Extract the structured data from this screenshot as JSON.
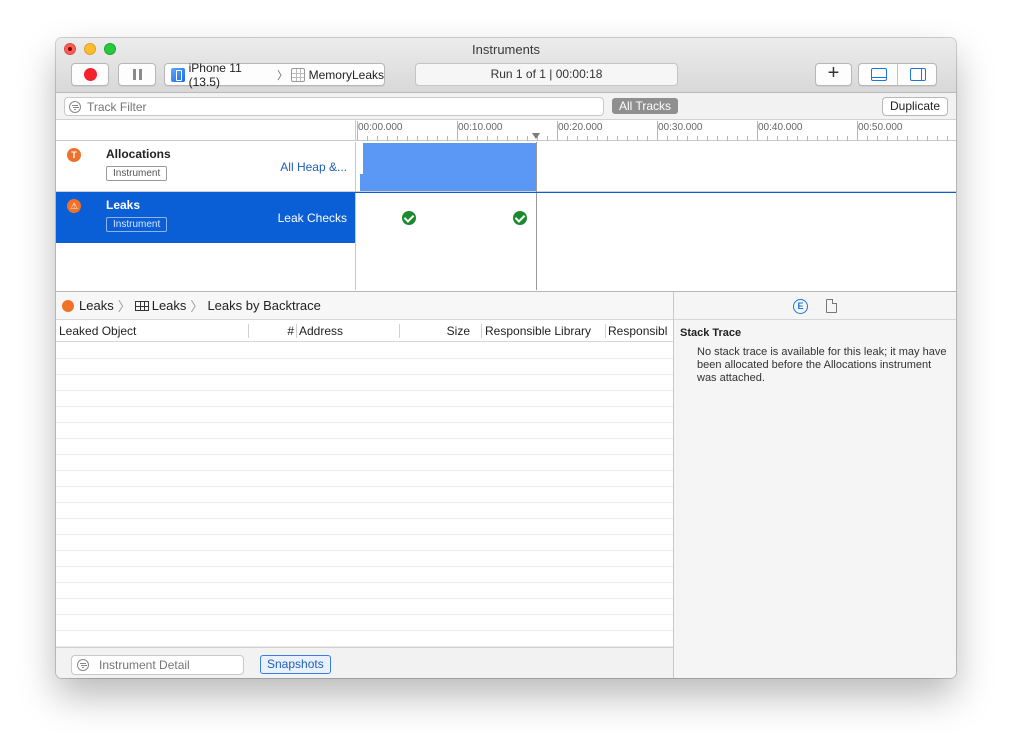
{
  "window": {
    "title": "Instruments"
  },
  "toolbar": {
    "device": "iPhone 11 (13.5)",
    "process": "MemoryLeaks",
    "status": "Run 1 of 1  |  00:00:18",
    "add_label": "+"
  },
  "filter_bar": {
    "track_filter_placeholder": "Track Filter",
    "all_tracks_label": "All Tracks",
    "duplicate_label": "Duplicate"
  },
  "ruler": {
    "labels": [
      "00:00.000",
      "00:10.000",
      "00:20.000",
      "00:30.000",
      "00:40.000",
      "00:50.000"
    ]
  },
  "tracks": [
    {
      "name": "Allocations",
      "badge": "Instrument",
      "subtitle": "All Heap &...",
      "icon": "allocations-icon",
      "icon_color": "#f0722a",
      "graph_color": "#5b97f5"
    },
    {
      "name": "Leaks",
      "badge": "Instrument",
      "subtitle": "Leak Checks",
      "icon": "leaks-icon",
      "icon_color": "#f0722a",
      "selected": true,
      "check_color": "#1b8a2f"
    }
  ],
  "selection_color": "#0a5fd6",
  "breadcrumb": [
    "Leaks",
    "Leaks",
    "Leaks by Backtrace"
  ],
  "table": {
    "columns": [
      "Leaked Object",
      "#",
      "Address",
      "Size",
      "Responsible Library",
      "Responsibl"
    ],
    "rows": []
  },
  "detail": {
    "filter_placeholder": "Instrument Detail",
    "snapshots_label": "Snapshots"
  },
  "inspector": {
    "title": "Stack Trace",
    "message": "No stack trace is available for this leak; it may have been allocated before the Allocations instrument was attached."
  }
}
